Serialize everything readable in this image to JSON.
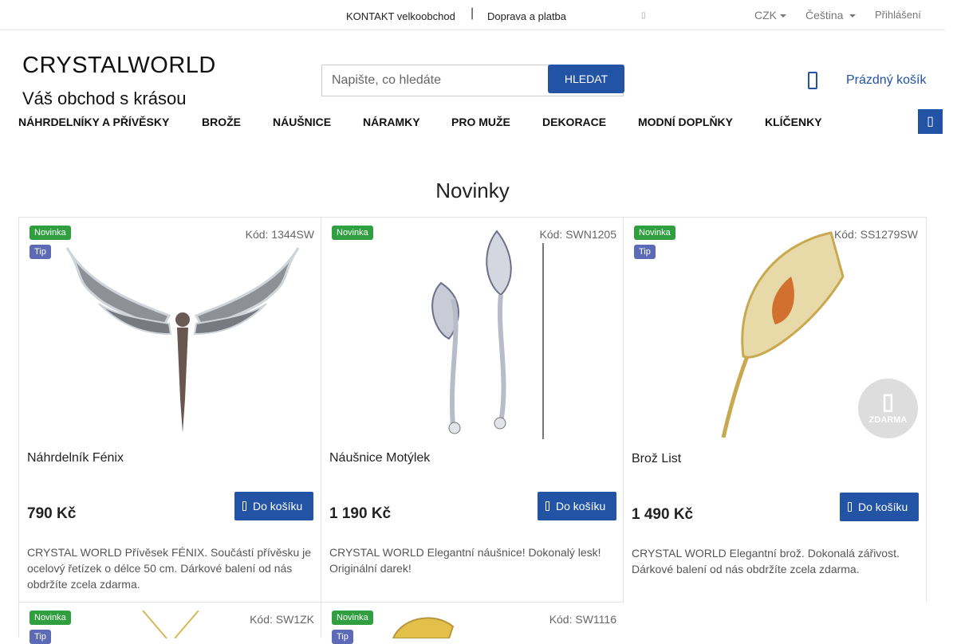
{
  "topbar": {
    "contact": "KONTAKT velkoobchod",
    "separator": "|",
    "shipping": "Doprava a platba",
    "currency": "CZK",
    "language": "Čeština",
    "login": "Přihlášení"
  },
  "header": {
    "logo": "CRYSTALWORLD",
    "tagline": "Váš obchod s krásou",
    "search_placeholder": "Napište, co hledáte",
    "search_button": "HLEDAT",
    "cart_label": "Prázdný košík"
  },
  "nav": {
    "items": [
      "NÁHRDELNÍKY A PŘÍVĚSKY",
      "BROŽE",
      "NÁUŠNICE",
      "NÁRAMKY",
      "PRO MUŽE",
      "DEKORACE",
      "MODNÍ DOPLŇKY",
      "KLÍČENKY"
    ]
  },
  "section_title": "Novinky",
  "labels": {
    "new": "Novinka",
    "tip": "Tip",
    "add_to_cart": "Do košíku",
    "free": "ZDARMA"
  },
  "products": [
    {
      "code": "Kód: 1344SW",
      "name": "Náhrdelník Fénix",
      "price": "790 Kč",
      "description": "CRYSTAL WORLD  Přívěsek FÉNIX. Součástí přívěsku je  ocelový řetízek o délce 50 cm. Dárkové balení od nás obdržíte zcela zdarma."
    },
    {
      "code": "Kód: SWN1205",
      "name": "Náušnice Motýlek",
      "price": "1 190 Kč",
      "description": "CRYSTAL WORLD  Elegantní náušnice! Dokonalý lesk! Originální darek!"
    },
    {
      "code": "Kód: SS1279SW",
      "name": "Brož List",
      "price": "1 490 Kč",
      "description": "CRYSTAL WORLD  Elegantní brož. Dokonalá zářivost. Dárkové balení od nás obdržíte zcela zdarma."
    },
    {
      "code": "Kód: SW1ZK"
    },
    {
      "code": "Kód: SW1116"
    }
  ],
  "colors": {
    "accent": "#2253a5",
    "badge_new": "#2f9f3f",
    "badge_tip": "#5d6ab8"
  },
  "icons": {
    "cart": "cart-icon",
    "menu": "menu-icon",
    "free_gift": "gift-icon"
  }
}
